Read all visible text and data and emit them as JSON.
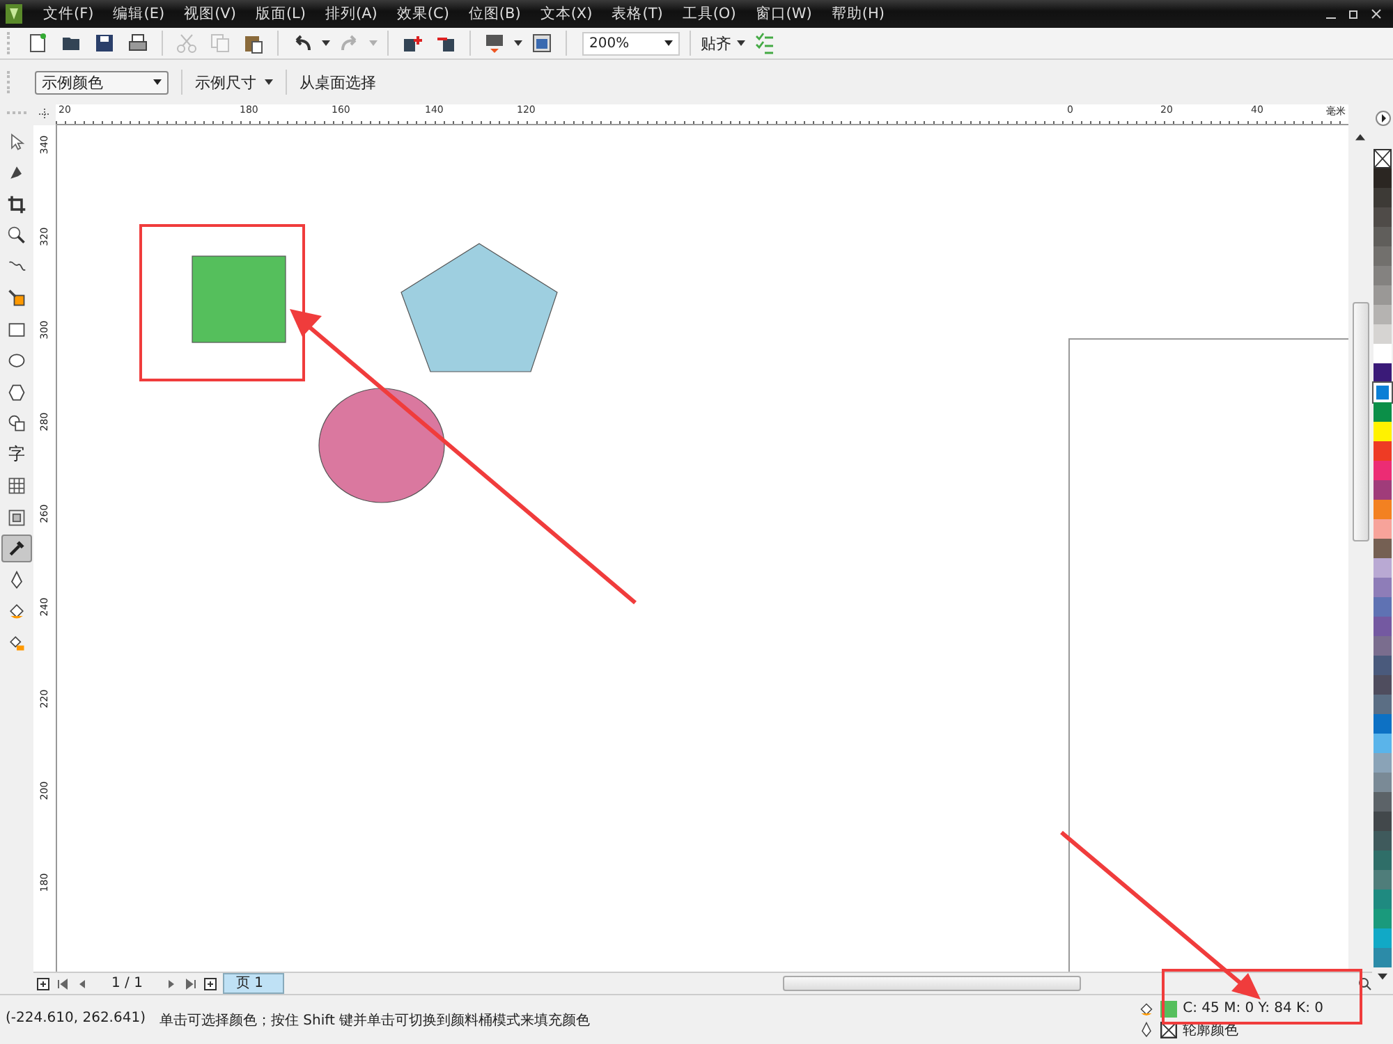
{
  "menu": [
    "文件(F)",
    "编辑(E)",
    "视图(V)",
    "版面(L)",
    "排列(A)",
    "效果(C)",
    "位图(B)",
    "文本(X)",
    "表格(T)",
    "工具(O)",
    "窗口(W)",
    "帮助(H)"
  ],
  "toolbar": {
    "items": [
      {
        "kind": "new",
        "disabled": false
      },
      {
        "kind": "open",
        "disabled": false
      },
      {
        "kind": "save",
        "disabled": false
      },
      {
        "kind": "print",
        "disabled": false
      },
      {
        "kind": "sep",
        "disabled": false
      },
      {
        "kind": "cut",
        "disabled": true
      },
      {
        "kind": "copy",
        "disabled": true
      },
      {
        "kind": "paste",
        "disabled": false
      },
      {
        "kind": "sep",
        "disabled": false
      },
      {
        "kind": "undo",
        "disabled": false
      },
      {
        "kind": "caret",
        "disabled": false
      },
      {
        "kind": "redo",
        "disabled": true
      },
      {
        "kind": "caret",
        "disabled": true
      },
      {
        "kind": "sep",
        "disabled": false
      },
      {
        "kind": "import",
        "disabled": false
      },
      {
        "kind": "export",
        "disabled": false
      },
      {
        "kind": "sep",
        "disabled": false
      },
      {
        "kind": "publish",
        "disabled": false
      },
      {
        "kind": "caret",
        "disabled": false
      },
      {
        "kind": "launcher",
        "disabled": false
      },
      {
        "kind": "sep",
        "disabled": false
      }
    ],
    "zoom": "200%",
    "snap": "贴齐"
  },
  "property_bar": {
    "color_mode": "示例颜色",
    "sample_size": "示例尺寸",
    "select_from_desktop": "从桌面选择"
  },
  "toolbox": [
    {
      "kind": "pick",
      "selected": false
    },
    {
      "kind": "shape",
      "selected": false
    },
    {
      "kind": "crop",
      "selected": false
    },
    {
      "kind": "zoom",
      "selected": false
    },
    {
      "kind": "freehand",
      "selected": false
    },
    {
      "kind": "smartfill",
      "selected": false
    },
    {
      "kind": "rect",
      "selected": false
    },
    {
      "kind": "ellipse",
      "selected": false
    },
    {
      "kind": "polygon",
      "selected": false
    },
    {
      "kind": "shapes",
      "selected": false
    },
    {
      "kind": "char",
      "label": "字",
      "selected": false
    },
    {
      "kind": "table",
      "selected": false
    },
    {
      "kind": "contour",
      "selected": false
    },
    {
      "kind": "eyedropper",
      "selected": true
    },
    {
      "kind": "pen",
      "selected": false
    },
    {
      "kind": "fill",
      "selected": false
    },
    {
      "kind": "ifill",
      "selected": false
    }
  ],
  "rulers": {
    "unit": "毫米",
    "horizontal": [
      "20",
      "180",
      "160",
      "140",
      "120",
      "0",
      "20",
      "40"
    ],
    "vertical": [
      "340",
      "320",
      "300",
      "280",
      "260",
      "240",
      "220",
      "200",
      "180"
    ]
  },
  "shapes": [
    {
      "kind": "square",
      "color": "#55bf5c"
    },
    {
      "kind": "pentagon",
      "color": "#9ecfe0"
    },
    {
      "kind": "ellipse",
      "color": "#da789f"
    }
  ],
  "page_nav": {
    "count": "1 / 1",
    "tab": "页 1"
  },
  "status": {
    "coords": "(-224.610, 262.641)",
    "hint": "单击可选择颜色；按住 Shift 键并单击可切换到颜料桶模式来填充颜色",
    "fill": {
      "color": "#55bf5c",
      "value": "C: 45 M: 0 Y: 84 K: 0"
    },
    "outline_label": "轮廓颜色"
  },
  "palette": [
    {
      "color": "#2b2622",
      "selected": false
    },
    {
      "color": "#3d3a36",
      "selected": false
    },
    {
      "color": "#4f4b48",
      "selected": false
    },
    {
      "color": "#605e5b",
      "selected": false
    },
    {
      "color": "#72706d",
      "selected": false
    },
    {
      "color": "#848280",
      "selected": false
    },
    {
      "color": "#9a9896",
      "selected": false
    },
    {
      "color": "#b5b3b1",
      "selected": false
    },
    {
      "color": "#d6d4d2",
      "selected": false
    },
    {
      "color": "#ffffff",
      "selected": false
    },
    {
      "color": "#3a1a78",
      "selected": false
    },
    {
      "color": "#0a7fd6",
      "selected": true
    },
    {
      "color": "#0b8f48",
      "selected": false
    },
    {
      "color": "#fff200",
      "selected": false
    },
    {
      "color": "#ee3b24",
      "selected": false
    },
    {
      "color": "#ec2c74",
      "selected": false
    },
    {
      "color": "#a03c7a",
      "selected": false
    },
    {
      "color": "#f38121",
      "selected": false
    },
    {
      "color": "#f7a39a",
      "selected": false
    },
    {
      "color": "#756053",
      "selected": false
    },
    {
      "color": "#b9a9d3",
      "selected": false
    },
    {
      "color": "#8e7db8",
      "selected": false
    },
    {
      "color": "#5f72b3",
      "selected": false
    },
    {
      "color": "#7459a1",
      "selected": false
    },
    {
      "color": "#7a6d8e",
      "selected": false
    },
    {
      "color": "#4a5a7c",
      "selected": false
    },
    {
      "color": "#4f4d5e",
      "selected": false
    },
    {
      "color": "#5b6e84",
      "selected": false
    },
    {
      "color": "#0d71c4",
      "selected": false
    },
    {
      "color": "#5ab4ea",
      "selected": false
    },
    {
      "color": "#8aa3b7",
      "selected": false
    },
    {
      "color": "#7a8a96",
      "selected": false
    },
    {
      "color": "#5c6368",
      "selected": false
    },
    {
      "color": "#42484b",
      "selected": false
    },
    {
      "color": "#3f5a5c",
      "selected": false
    },
    {
      "color": "#2f6e68",
      "selected": false
    },
    {
      "color": "#4f7d7a",
      "selected": false
    },
    {
      "color": "#1f8a80",
      "selected": false
    },
    {
      "color": "#1a9a7c",
      "selected": false
    },
    {
      "color": "#11a9c6",
      "selected": false
    },
    {
      "color": "#2c8ba8",
      "selected": false
    }
  ]
}
